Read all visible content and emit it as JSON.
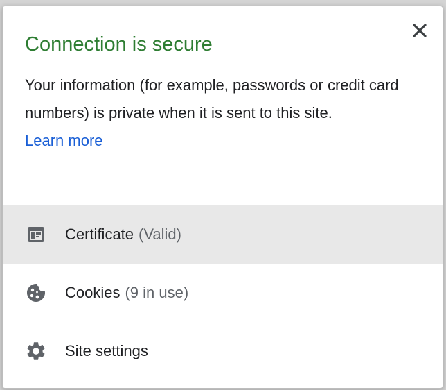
{
  "popup": {
    "title": "Connection is secure",
    "description": "Your information (for example, passwords or credit card numbers) is private when it is sent to this site.",
    "learn_more": "Learn more",
    "close_icon": "close-icon"
  },
  "menu": {
    "items": [
      {
        "label": "Certificate",
        "sub": "(Valid)",
        "icon": "certificate-icon"
      },
      {
        "label": "Cookies",
        "sub": "(9 in use)",
        "icon": "cookie-icon"
      },
      {
        "label": "Site settings",
        "sub": "",
        "icon": "gear-icon"
      }
    ]
  },
  "colors": {
    "title": "#2e7d32",
    "link": "#1a5fd6",
    "hover_bg": "#e8e8e8",
    "icon": "#5f6368"
  }
}
